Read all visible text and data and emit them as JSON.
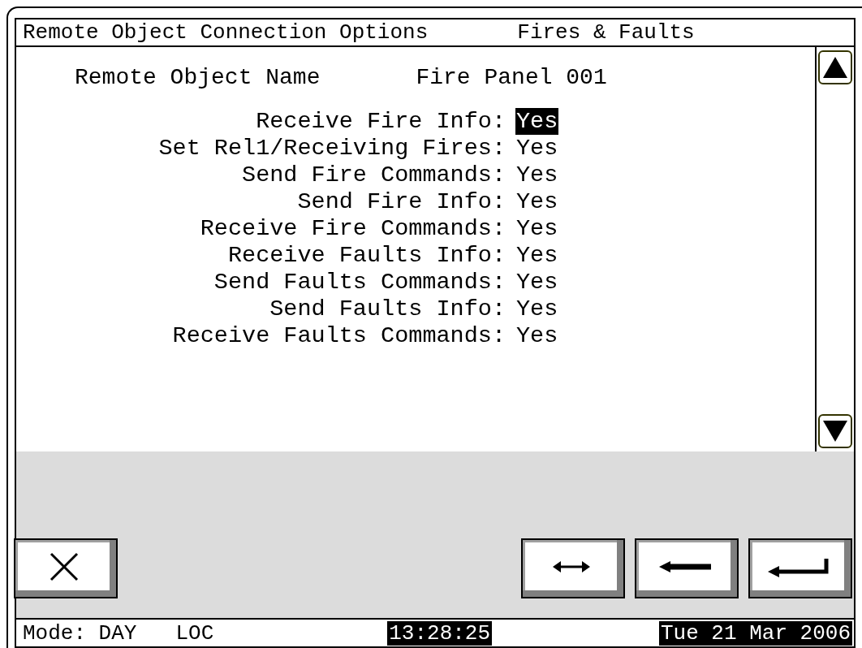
{
  "header": {
    "title": "Remote Object Connection Options",
    "section": "Fires & Faults"
  },
  "object": {
    "label": "Remote Object Name",
    "value": "Fire Panel 001"
  },
  "fields": [
    {
      "label": "Receive Fire Info:",
      "value": "Yes",
      "selected": true
    },
    {
      "label": "Set Rel1/Receiving Fires:",
      "value": "Yes",
      "selected": false
    },
    {
      "label": "Send Fire Commands:",
      "value": "Yes",
      "selected": false
    },
    {
      "label": "Send Fire Info:",
      "value": "Yes",
      "selected": false
    },
    {
      "label": "Receive Fire Commands:",
      "value": "Yes",
      "selected": false
    },
    {
      "label": "Receive Faults Info:",
      "value": "Yes",
      "selected": false
    },
    {
      "label": "Send Faults Commands:",
      "value": "Yes",
      "selected": false
    },
    {
      "label": "Send Faults Info:",
      "value": "Yes",
      "selected": false
    },
    {
      "label": "Receive Faults Commands:",
      "value": "Yes",
      "selected": false
    }
  ],
  "buttons": [
    {
      "kind": "cancel"
    },
    {
      "kind": "switch"
    },
    {
      "kind": "back"
    },
    {
      "kind": "enter"
    }
  ],
  "status_bar": {
    "mode": "Mode: DAY",
    "location": "LOC",
    "time": "13:28:25",
    "date": "Tue 21 Mar 2006"
  }
}
